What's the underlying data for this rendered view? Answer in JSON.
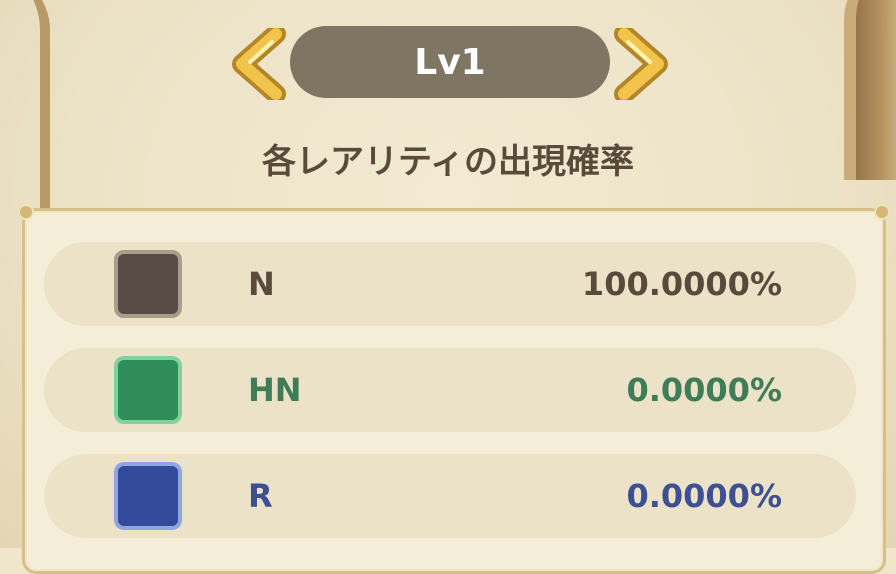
{
  "level": {
    "label": "Lv1",
    "prev_icon": "chevron-left-icon",
    "next_icon": "chevron-right-icon"
  },
  "section_title": "各レアリティの出現確率",
  "rarities": [
    {
      "name": "N",
      "probability": "100.0000%",
      "text_color": "#5a4a3c",
      "swatch_fill": "#564c45",
      "swatch_border": "#a89c8a"
    },
    {
      "name": "HN",
      "probability": "0.0000%",
      "text_color": "#3e7d57",
      "swatch_fill": "#2f8d5a",
      "swatch_border": "#7fd29d"
    },
    {
      "name": "R",
      "probability": "0.0000%",
      "text_color": "#3e4f93",
      "swatch_fill": "#334b9a",
      "swatch_border": "#8fa6e3"
    }
  ],
  "colors": {
    "gold_arrow": "#f3c44b",
    "level_pill": "#7e7563",
    "panel_bg": "#f4edd8"
  }
}
